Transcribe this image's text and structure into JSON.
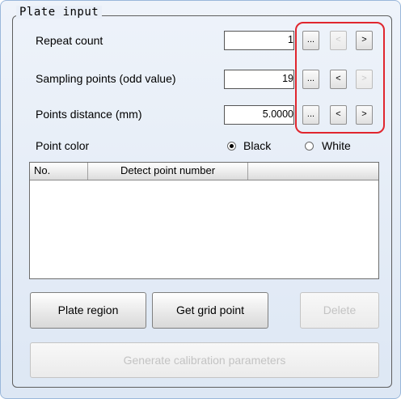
{
  "group": {
    "title": "Plate input"
  },
  "fields": [
    {
      "label": "Repeat count",
      "value": "1",
      "ellipsis": "...",
      "prev": "<",
      "next": ">"
    },
    {
      "label": "Sampling points (odd value)",
      "value": "19",
      "ellipsis": "...",
      "prev": "<",
      "next": ">"
    },
    {
      "label": "Points distance (mm)",
      "value": "5.0000",
      "ellipsis": "...",
      "prev": "<",
      "next": ">"
    }
  ],
  "point_color": {
    "label": "Point color",
    "options": [
      {
        "label": "Black",
        "selected": true
      },
      {
        "label": "White",
        "selected": false
      }
    ]
  },
  "list": {
    "columns": [
      "No.",
      "Detect point number"
    ],
    "rows": []
  },
  "buttons": {
    "plate_region": "Plate region",
    "get_grid_point": "Get grid point",
    "delete": "Delete",
    "generate": "Generate calibration parameters"
  },
  "colors": {
    "highlight": "#e0262e",
    "panel_border": "#9ab7da",
    "panel_bg": "#e3ebf6"
  }
}
